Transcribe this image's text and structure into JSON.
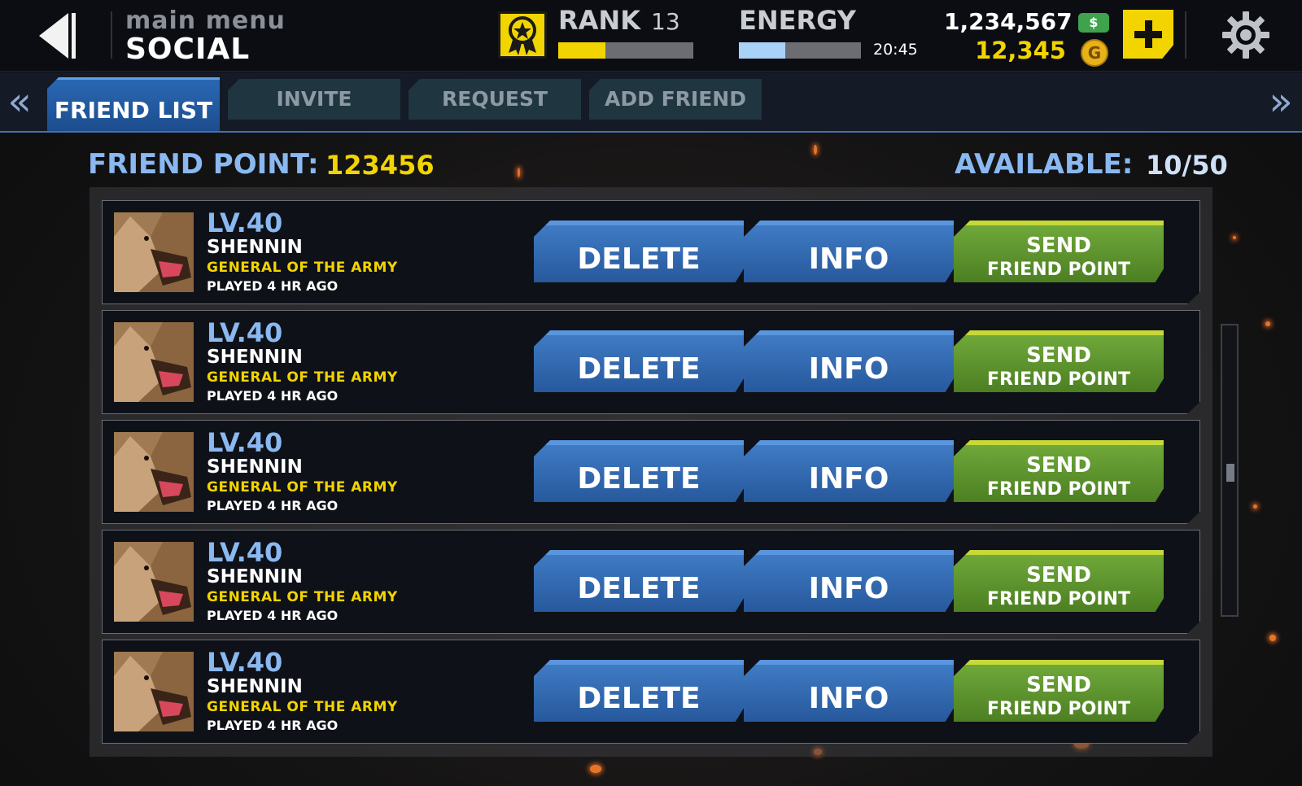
{
  "header": {
    "breadcrumb_parent": "main menu",
    "page_title": "SOCIAL",
    "rank_label": "RANK",
    "rank_value": "13",
    "rank_progress": 0.35,
    "energy_label": "ENERGY",
    "energy_progress": 0.38,
    "energy_timer": "20:45",
    "cash_value": "1,234,567",
    "cash_icon_text": "$",
    "gold_value": "12,345",
    "gold_icon_text": "G"
  },
  "tabs": [
    {
      "label": "FRIEND LIST",
      "active": true
    },
    {
      "label": "INVITE",
      "active": false
    },
    {
      "label": "REQUEST",
      "active": false
    },
    {
      "label": "ADD FRIEND",
      "active": false
    }
  ],
  "tab_arrows": {
    "left": "«",
    "right": "»"
  },
  "summary": {
    "friend_point_label": "FRIEND POINT:",
    "friend_point_value": "123456",
    "available_label": "AVAILABLE:",
    "available_value": "10/50"
  },
  "friends": [
    {
      "level": "LV.40",
      "name": "SHENNIN",
      "title": "GENERAL OF THE ARMY",
      "played": "PLAYED 4 HR AGO"
    },
    {
      "level": "LV.40",
      "name": "SHENNIN",
      "title": "GENERAL OF THE ARMY",
      "played": "PLAYED 4 HR AGO"
    },
    {
      "level": "LV.40",
      "name": "SHENNIN",
      "title": "GENERAL OF THE ARMY",
      "played": "PLAYED 4 HR AGO"
    },
    {
      "level": "LV.40",
      "name": "SHENNIN",
      "title": "GENERAL OF THE ARMY",
      "played": "PLAYED 4 HR AGO"
    },
    {
      "level": "LV.40",
      "name": "SHENNIN",
      "title": "GENERAL OF THE ARMY",
      "played": "PLAYED 4 HR AGO"
    }
  ],
  "buttons": {
    "delete": "DELETE",
    "info": "INFO",
    "send_line1": "SEND",
    "send_line2": "FRIEND POINT"
  },
  "colors": {
    "accent_yellow": "#f2d400",
    "accent_blue": "#8ab8f0",
    "button_blue": "#2f67ad",
    "button_green": "#5b9130"
  }
}
